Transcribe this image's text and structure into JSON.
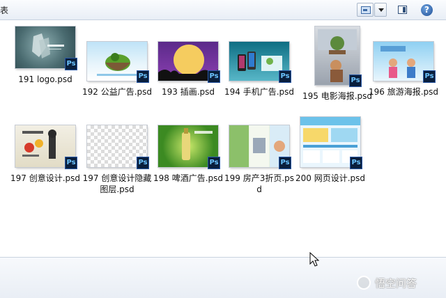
{
  "toolbar": {
    "left_text": "表",
    "views_icon": "change-view-icon",
    "views_dropdown_icon": "chevron-down-icon",
    "preview_pane_icon": "preview-pane-icon",
    "help_icon": "help-icon",
    "help_label": "?"
  },
  "files": [
    {
      "name": "191 logo.psd",
      "badge": "Ps"
    },
    {
      "name": "192 公益广告.psd",
      "badge": "Ps"
    },
    {
      "name": "193 插画.psd",
      "badge": "Ps"
    },
    {
      "name": "194 手机广告.psd",
      "badge": "Ps"
    },
    {
      "name": "195 电影海报.psd",
      "badge": "Ps"
    },
    {
      "name": "196 旅游海报.psd",
      "badge": "Ps"
    },
    {
      "name": "197 创意设计.psd",
      "badge": "Ps"
    },
    {
      "name": "197 创意设计隐藏图层.psd",
      "badge": "Ps"
    },
    {
      "name": "198 啤酒广告.psd",
      "badge": "Ps"
    },
    {
      "name": "199 房产3折页.psd",
      "badge": "Ps"
    },
    {
      "name": "200 网页设计.psd",
      "badge": "Ps"
    }
  ],
  "watermark": {
    "text": "悟空问答"
  },
  "colors": {
    "accent": "#3d6aa5",
    "ps_badge_bg": "#0a1f3d",
    "ps_badge_text": "#6cc4ff"
  }
}
